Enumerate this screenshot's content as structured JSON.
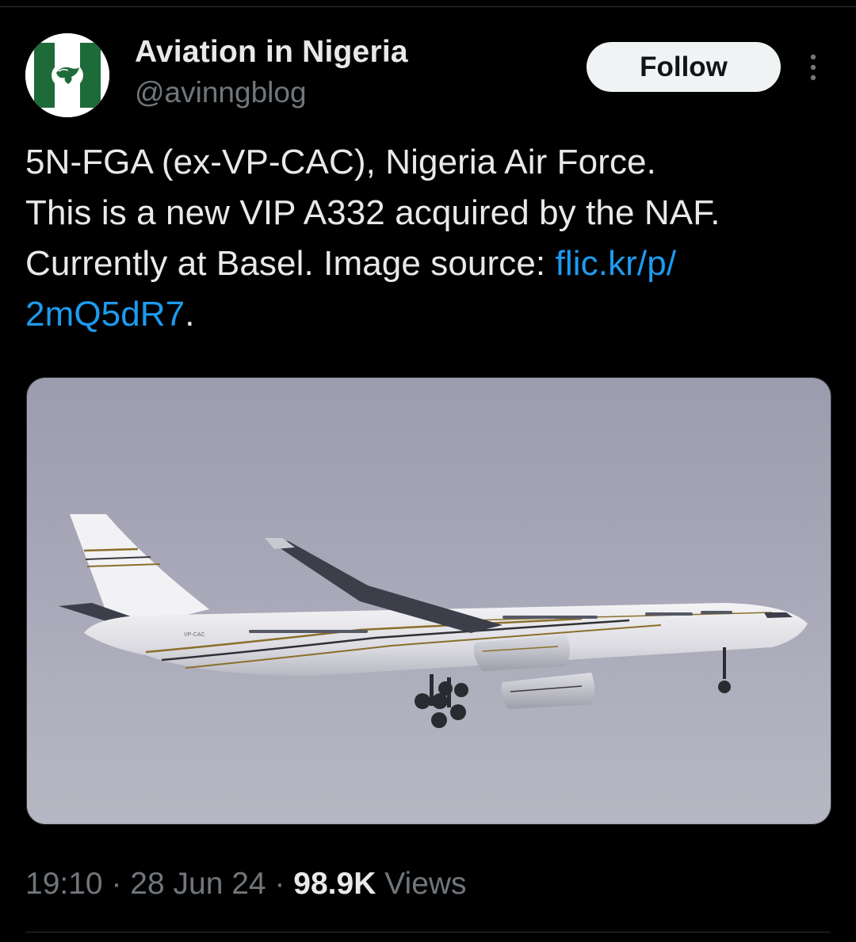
{
  "author": {
    "display_name": "Aviation in Nigeria",
    "handle": "@avinngblog",
    "avatar_icon": "aviation-in-nigeria-logo-icon",
    "avatar_colors": {
      "green": "#1e6b3a",
      "white": "#ffffff"
    }
  },
  "actions": {
    "follow_label": "Follow",
    "more_icon": "more-vertical-icon"
  },
  "tweet": {
    "text_line_1": "5N-FGA (ex-VP-CAC), Nigeria Air Force.",
    "text_line_2": "This is a new VIP A332 acquired by the NAF.",
    "text_line_3_prefix": "Currently at Basel. Image source: ",
    "link_part_1": "flic.kr/p/",
    "link_part_2": "2mQ5dR7",
    "text_suffix": ".",
    "link_color": "#1d9bf0"
  },
  "media": {
    "kind": "photo",
    "aircraft_livery_text": "VP-CAC",
    "sky_color": "#a8a8b8"
  },
  "meta": {
    "time": "19:10",
    "separator": "·",
    "date": "28 Jun 24",
    "views_count": "98.9K",
    "views_label": "Views"
  },
  "colors": {
    "background": "#000000",
    "text_primary": "#e7e9ea",
    "text_secondary": "#71767b",
    "follow_bg": "#eff3f4",
    "follow_text": "#0f1419",
    "divider": "#2f3336"
  }
}
